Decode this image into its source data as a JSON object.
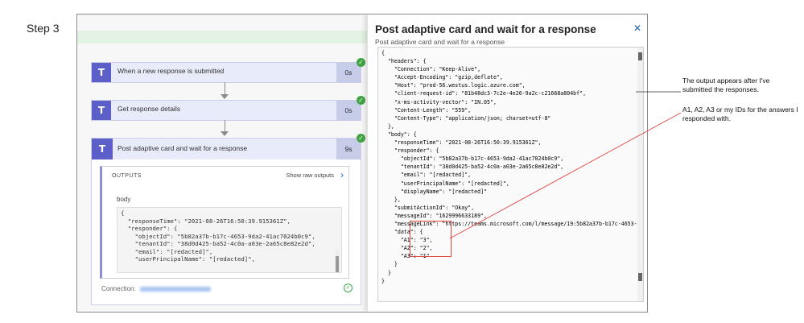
{
  "step_label": "Step 3",
  "flow": {
    "steps": [
      {
        "title": "When a new response is submitted",
        "duration": "0s"
      },
      {
        "title": "Get response details",
        "duration": "0s"
      },
      {
        "title": "Post adaptive card and wait for a response",
        "duration": "9s"
      }
    ],
    "outputs": {
      "title": "OUTPUTS",
      "show_raw": "Show raw outputs",
      "body_label": "body",
      "code_lines": [
        "{",
        "  \"responseTime\": \"2021-08-26T16:50:39.915361Z\",",
        "  \"responder\": {",
        "    \"objectId\": \"5b82a37b-b17c-4653-9da2-41ac7024b0c9\",",
        "    \"tenantId\": \"38d0d425-ba52-4c0a-a03e-2a65c8e82e2d\",",
        "    \"email\": \"[redacted]\",",
        "    \"userPrincipalName\": \"[redacted]\","
      ]
    },
    "connection_label": "Connection:"
  },
  "panel": {
    "title": "Post adaptive card and wait for a response",
    "subtitle": "Post adaptive card and wait for a response",
    "close_icon": "close-icon",
    "json_lines": [
      "{",
      "  \"headers\": {",
      "    \"Connection\": \"Keep-Alive\",",
      "    \"Accept-Encoding\": \"gzip,deflate\",",
      "    \"Host\": \"prod-56.westus.logic.azure.com\",",
      "    \"client-request-id\": \"81b48dc3-7c2e-4e26-9a2c-c21668a804bf\",",
      "    \"x-ms-activity-vector\": \"IN.05\",",
      "    \"Content-Length\": \"559\",",
      "    \"Content-Type\": \"application/json; charset=utf-8\"",
      "  },",
      "  \"body\": {",
      "    \"responseTime\": \"2021-08-26T16:50:39.915361Z\",",
      "    \"responder\": {",
      "      \"objectId\": \"5b82a37b-b17c-4653-9da2-41ac7024b0c9\",",
      "      \"tenantId\": \"38d0d425-ba52-4c0a-a03e-2a65c8e82e2d\",",
      "      \"email\": \"[redacted]\",",
      "      \"userPrincipalName\": \"[redacted]\",",
      "      \"displayName\": \"[redacted]\"",
      "    },",
      "    \"submitActionId\": \"Okay\",",
      "    \"messageId\": \"1629996633189\",",
      "    \"messageLink\": \"https://teams.microsoft.com/l/message/19:5b82a37b-b17c-4653-9",
      "    \"data\": {",
      "      \"A1\": \"3\",",
      "      \"A2\": \"2\",",
      "      \"A3\": \"1\"",
      "    }",
      "  }",
      "}"
    ]
  },
  "annotations": {
    "note1": "The output appears after I've submitted the responses.",
    "note2": "A1, A2, A3 or my IDs for the answers I responded with."
  },
  "colors": {
    "accent": "#5b5fc7",
    "success": "#3fa442",
    "highlight": "#e0443e"
  }
}
